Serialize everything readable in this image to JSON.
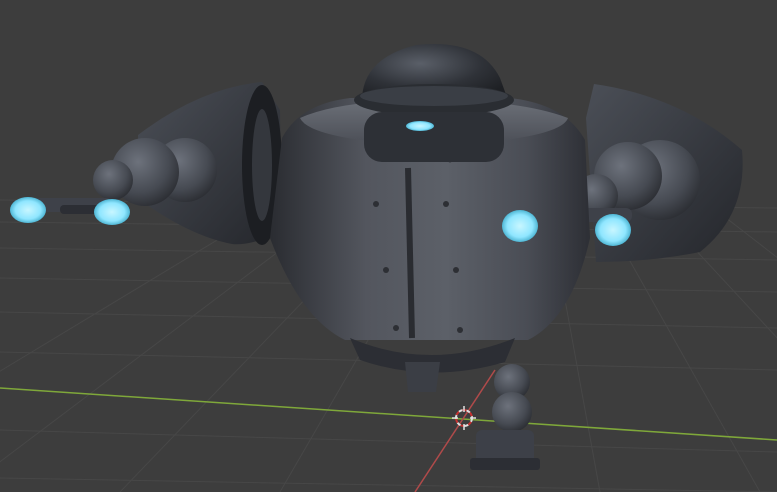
{
  "viewport": {
    "background": "#3d3d3d",
    "grid_color": "#4a4a4a",
    "x_axis_color": "#7fa83a",
    "y_axis_color": "#b04a4a",
    "cursor_colors": {
      "primary": "#e0e0e0",
      "accent": "#c83232"
    }
  },
  "model": {
    "body_color": "#4a4d55",
    "body_dark": "#2c2e34",
    "glow_color": "#8fe6ff"
  }
}
